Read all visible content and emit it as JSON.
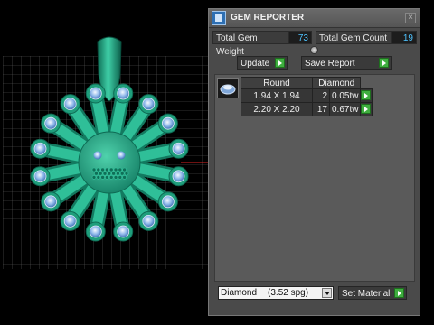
{
  "panel": {
    "title": "GEM REPORTER",
    "close_glyph": "×",
    "total_weight_label": "Total Gem Weight",
    "total_weight_value": ".73",
    "total_count_label": "Total Gem Count",
    "total_count_value": "19",
    "update_label": "Update",
    "save_report_label": "Save Report",
    "columns": {
      "shape": "Round",
      "material": "Diamond"
    },
    "rows": [
      {
        "size": "1.94 X 1.94",
        "count": "2",
        "weight": "0.05tw"
      },
      {
        "size": "2.20 X 2.20",
        "count": "17",
        "weight": "0.67tw"
      }
    ],
    "material_select": {
      "name": "Diamond",
      "density": "(3.52 spg)"
    },
    "set_material_label": "Set Material"
  },
  "colors": {
    "model": "#1f9e7c",
    "gem": "#8fb8ea",
    "grid": "#6a6a6a",
    "value_text": "#4ec3ff",
    "go_button": "#3fae3f"
  },
  "icons": [
    "app-icon",
    "close-icon",
    "go-arrow-icon",
    "gem-icon",
    "dropdown-arrow-icon"
  ]
}
